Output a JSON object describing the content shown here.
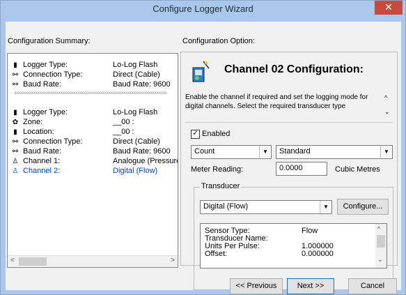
{
  "window": {
    "title": "Configure Logger Wizard",
    "close_glyph": "✕"
  },
  "summary": {
    "label": "Configuration Summary:",
    "rows": [
      {
        "icon": "logger-icon",
        "glyph": "▮",
        "key": "Logger Type:",
        "value": "Lo-Log Flash"
      },
      {
        "icon": "connection-icon",
        "glyph": "⚯",
        "key": "Connection Type:",
        "value": "Direct (Cable)"
      },
      {
        "icon": "baud-icon",
        "glyph": "⚯",
        "key": "Baud Rate:",
        "value": "Baud Rate: 9600"
      },
      {
        "icon": "logger-icon",
        "glyph": "▮",
        "key": "Logger Type:",
        "value": "Lo-Log Flash"
      },
      {
        "icon": "zone-icon",
        "glyph": "✿",
        "key": "Zone:",
        "value": "__00 :"
      },
      {
        "icon": "location-icon",
        "glyph": "▮",
        "key": "Location:",
        "value": "__00 :"
      },
      {
        "icon": "connection-icon",
        "glyph": "⚯",
        "key": "Connection Type:",
        "value": "Direct (Cable)"
      },
      {
        "icon": "baud-icon",
        "glyph": "⚯",
        "key": "Baud Rate:",
        "value": "Baud Rate: 9600"
      },
      {
        "icon": "channel-icon",
        "glyph": "♙",
        "key": "Channel 1:",
        "value": "Analogue (Pressure)"
      },
      {
        "icon": "channel-icon",
        "glyph": "♙",
        "key": "Channel 2:",
        "value": "Digital (Flow)"
      }
    ],
    "separator": "xxxxxxxxxxxxxxxxxxxxxxxxxxxxxxxxxxxxxxxxxxxxxxxxxxxxxxxxxxxxxxxxxxxxxxxxx"
  },
  "option": {
    "label": "Configuration Option:",
    "heading": "Channel 02 Configuration:",
    "description": "Enable the channel if required and set the logging mode for digital channels. Select the required transducer type",
    "enabled_label": "Enabled",
    "enabled_check": "✓",
    "mode_value": "Count",
    "type_value": "Standard",
    "meter_label": "Meter Reading:",
    "meter_value": "0.0000",
    "meter_unit": "Cubic Metres"
  },
  "transducer": {
    "group_label": "Transducer",
    "select_value": "Digital (Flow)",
    "configure_label": "Configure...",
    "props": [
      {
        "key": "Sensor Type:",
        "value": "Flow"
      },
      {
        "key": "Transducer Name:",
        "value": ""
      },
      {
        "key": "Units Per Pulse:",
        "value": "1.000000"
      },
      {
        "key": "Offset:",
        "value": "0.000000"
      }
    ]
  },
  "buttons": {
    "previous": "<< Previous",
    "next": "Next >>",
    "cancel": "Cancel"
  }
}
